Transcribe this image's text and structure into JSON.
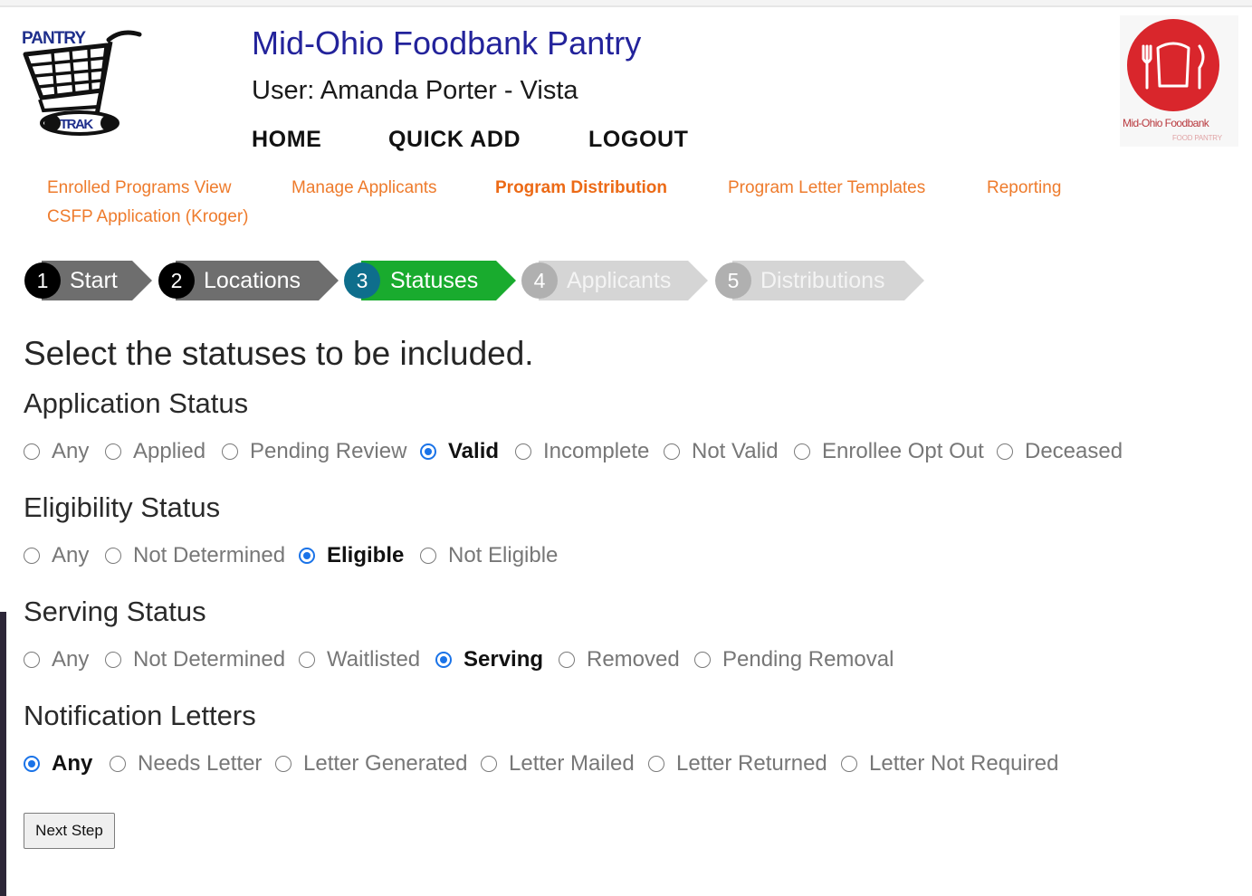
{
  "header": {
    "site_title": "Mid-Ohio Foodbank Pantry",
    "user_line": "User: Amanda Porter - Vista",
    "nav": [
      "HOME",
      "QUICK ADD",
      "LOGOUT"
    ],
    "logo_left_icon": "pantry-trak-cart-logo",
    "logo_right_icon": "mid-ohio-foodbank-logo",
    "logo_right_text": "Mid-Ohio Foodbank",
    "logo_right_subtext": "FOOD PANTRY"
  },
  "subnav": {
    "items": [
      "Enrolled Programs View",
      "Manage Applicants",
      "Program Distribution",
      "Program Letter Templates",
      "Reporting",
      "CSFP Application (Kroger)"
    ],
    "active": "Program Distribution"
  },
  "wizard": {
    "steps": [
      {
        "num": "1",
        "label": "Start",
        "state": "done"
      },
      {
        "num": "2",
        "label": "Locations",
        "state": "done"
      },
      {
        "num": "3",
        "label": "Statuses",
        "state": "current"
      },
      {
        "num": "4",
        "label": "Applicants",
        "state": "upcoming"
      },
      {
        "num": "5",
        "label": "Distributions",
        "state": "upcoming"
      }
    ]
  },
  "form": {
    "prompt": "Select the statuses to be included.",
    "groups": [
      {
        "title": "Application Status",
        "options": [
          "Any",
          "Applied",
          "Pending Review",
          "Valid",
          "Incomplete",
          "Not Valid",
          "Enrollee Opt Out",
          "Deceased"
        ],
        "selected": "Valid"
      },
      {
        "title": "Eligibility Status",
        "options": [
          "Any",
          "Not Determined",
          "Eligible",
          "Not Eligible"
        ],
        "selected": "Eligible"
      },
      {
        "title": "Serving Status",
        "options": [
          "Any",
          "Not Determined",
          "Waitlisted",
          "Serving",
          "Removed",
          "Pending Removal"
        ],
        "selected": "Serving"
      },
      {
        "title": "Notification Letters",
        "options": [
          "Any",
          "Needs Letter",
          "Letter Generated",
          "Letter Mailed",
          "Letter Returned",
          "Letter Not Required"
        ],
        "selected": "Any"
      }
    ],
    "next_label": "Next Step"
  },
  "colors": {
    "title_blue": "#23239b",
    "link_orange": "#ee7b2c",
    "step_done": "#6e6e6e",
    "step_current": "#19ab2e",
    "step_current_circle": "#0e6e8c",
    "step_upcoming": "#d5d5d5",
    "radio_blue": "#1a73e8"
  }
}
